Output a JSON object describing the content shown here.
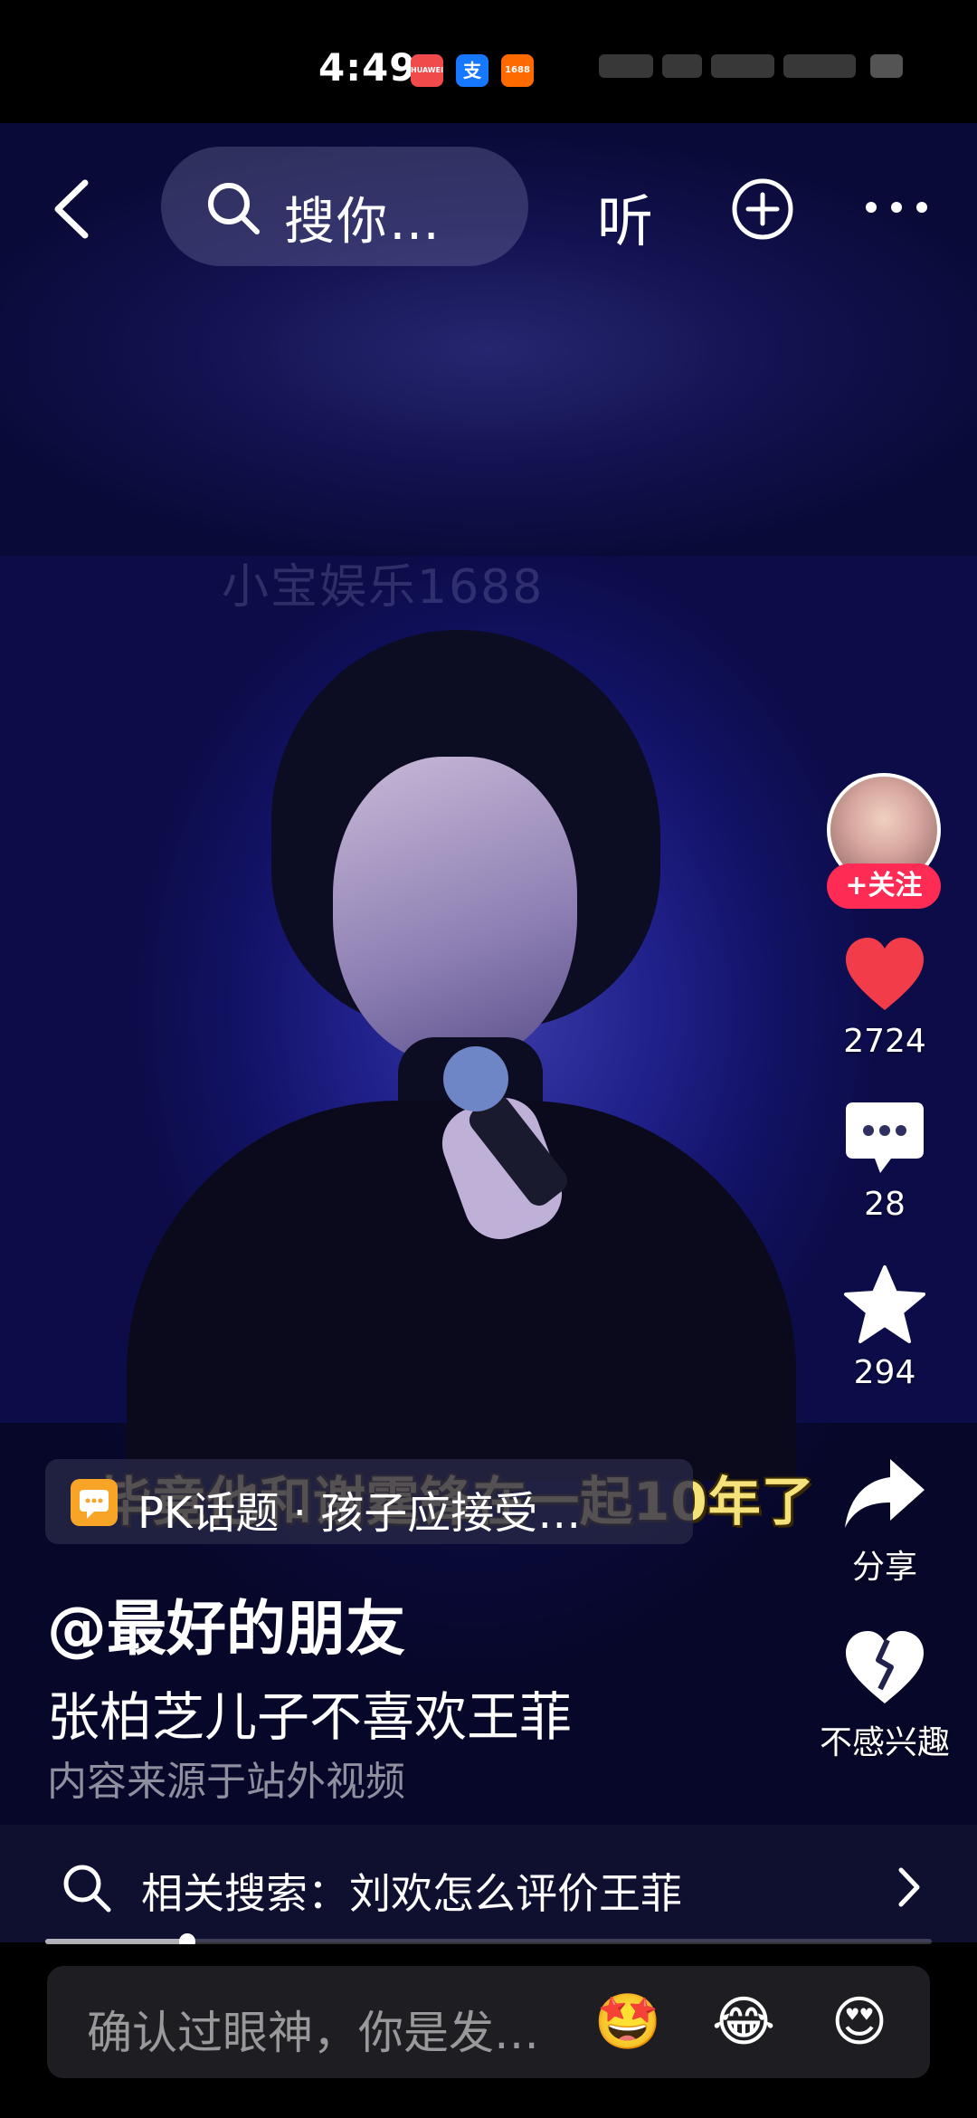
{
  "status_bar": {
    "time": "4:49",
    "app_icons": [
      {
        "name": "huawei-app-icon",
        "label": "HUAWEI",
        "color": "#f04a4a"
      },
      {
        "name": "alipay-app-icon",
        "label": "支",
        "color": "#1677ff"
      },
      {
        "name": "1688-app-icon",
        "label": "1688",
        "color": "#ff6a00"
      }
    ]
  },
  "top_bar": {
    "search_text": "搜你…",
    "listen_label": "听"
  },
  "video": {
    "watermark": "小宝娱乐1688",
    "subtitle": "毕竟他和谢霆锋在一起10年了"
  },
  "right_rail": {
    "follow_label": "+关注",
    "like_count": "2724",
    "comment_count": "28",
    "favorite_count": "294",
    "share_label": "分享",
    "not_interested_label": "不感兴趣",
    "like_color": "#f23c4a"
  },
  "info": {
    "pk_topic": "PK话题 · 孩子应接受…",
    "author": "@最好的朋友",
    "description": "张柏芝儿子不喜欢王菲",
    "source_note": "内容来源于站外视频"
  },
  "related_search": {
    "text": "相关搜索：刘欢怎么评价王菲"
  },
  "playback": {
    "progress_fraction": 0.16
  },
  "comment_bar": {
    "placeholder": "确认过眼神，你是发…",
    "emojis": [
      "🤩",
      "😂",
      "😍"
    ]
  }
}
